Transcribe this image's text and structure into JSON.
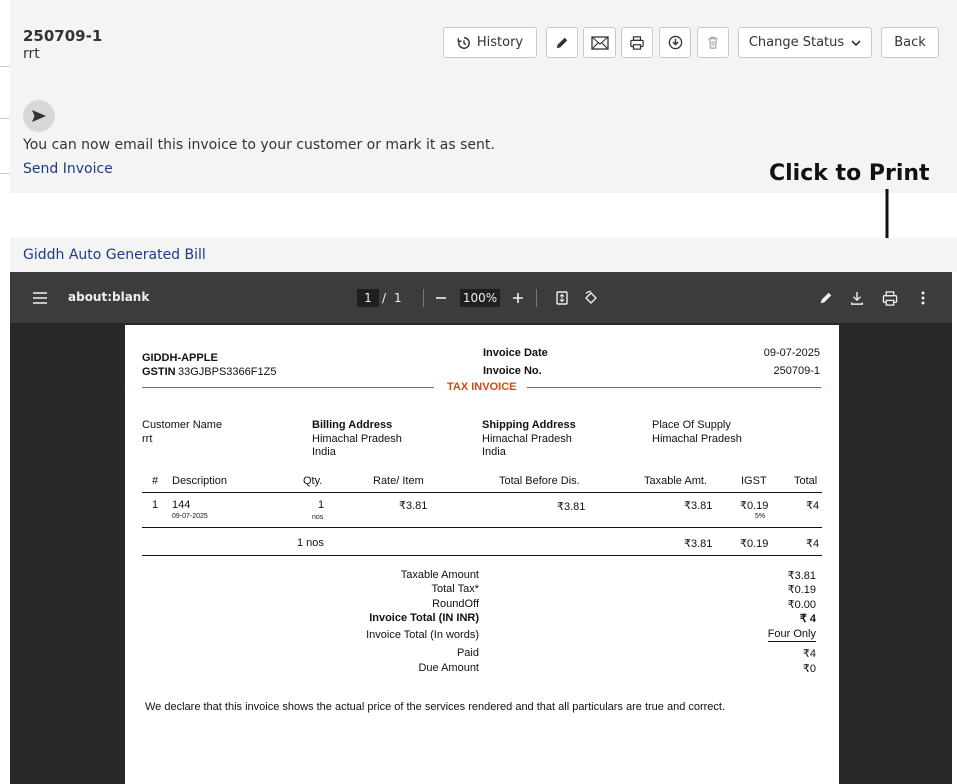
{
  "invoice": {
    "number": "250709-1",
    "customer_short": "rrt"
  },
  "toolbar_buttons": {
    "history": "History",
    "change_status": "Change Status",
    "back": "Back"
  },
  "send": {
    "message": "You can now email this invoice to your customer or mark it as sent.",
    "link": "Send Invoice"
  },
  "annotation": "Click to Print",
  "bill_section": {
    "label": "Giddh Auto Generated Bill"
  },
  "pdf_viewer": {
    "title": "about:blank",
    "page_current": "1",
    "page_sep": "/",
    "page_total": "1",
    "zoom": "100%"
  },
  "pdf": {
    "company": "GIDDH-APPLE",
    "gstin_label": "GSTIN",
    "gstin": "33GJBPS3366F1Z5",
    "invoice_date_label": "Invoice Date",
    "invoice_date": "09-07-2025",
    "invoice_no_label": "Invoice No.",
    "invoice_no": "250709-1",
    "doc_title": "TAX INVOICE",
    "customer_name_label": "Customer Name",
    "customer_name": "rrt",
    "billing_label": "Billing Address",
    "billing_line1": "Himachal Pradesh",
    "billing_line2": "India",
    "shipping_label": "Shipping Address",
    "shipping_line1": "Himachal Pradesh",
    "shipping_line2": "India",
    "pos_label": "Place Of Supply",
    "pos": "Himachal Pradesh",
    "columns": [
      "#",
      "Description",
      "Qty.",
      "Rate/ Item",
      "Total Before Dis.",
      "Taxable Amt.",
      "IGST",
      "Total"
    ],
    "row": {
      "idx": "1",
      "desc": "144",
      "desc_date": "09-07-2025",
      "qty": "1",
      "qty_unit": "nos",
      "rate": "₹3.81",
      "before_dis": "₹3.81",
      "taxable": "₹3.81",
      "igst": "₹0.19",
      "igst_rate": "5%",
      "total": "₹4"
    },
    "totals_row": {
      "qty": "1 nos",
      "taxable": "₹3.81",
      "igst": "₹0.19",
      "total": "₹4"
    },
    "summary": {
      "taxable_label": "Taxable Amount",
      "taxable": "₹3.81",
      "tax_label": "Total Tax*",
      "tax": "₹0.19",
      "roundoff_label": "RoundOff",
      "roundoff": "₹0.00",
      "total_label": "Invoice Total (IN INR)",
      "total": "₹ 4",
      "words_label": "Invoice Total (In words)",
      "words": "Four Only",
      "paid_label": "Paid",
      "paid": "₹4",
      "due_label": "Due Amount",
      "due": "₹0"
    },
    "declaration": "We declare that this invoice shows the actual price of the services rendered and that all particulars are true and correct."
  }
}
